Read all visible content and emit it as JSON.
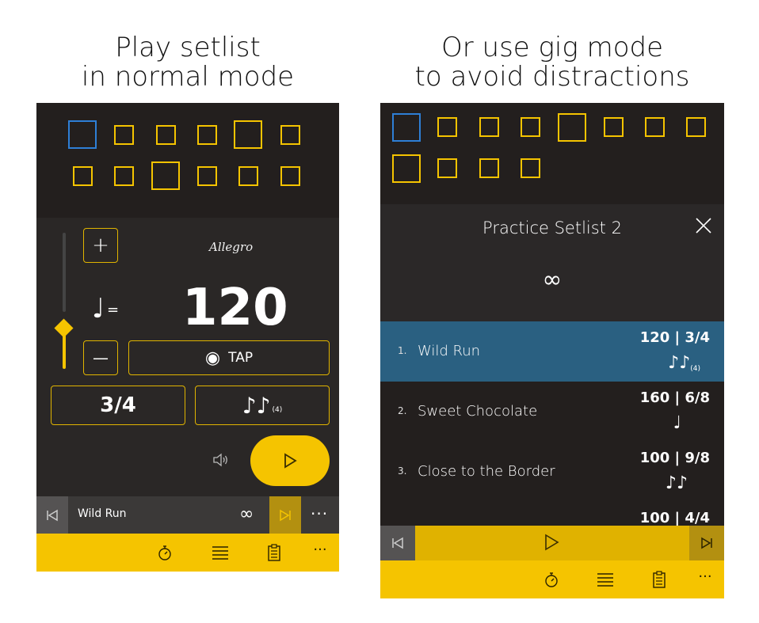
{
  "captions": {
    "left": [
      "Play setlist",
      "in normal mode"
    ],
    "right": [
      "Or use gig mode",
      "to avoid distractions"
    ]
  },
  "normal_mode": {
    "tempo_name": "Allegro",
    "note_symbol": "♩",
    "equals": "=",
    "bpm": "120",
    "plus_label": "+",
    "minus_label": "—",
    "tap_icon": "◉",
    "tap_label": "TAP",
    "time_signature": "3/4",
    "subdivision_notes": "♪♪",
    "subdivision_count": "(4)",
    "volume_icon": "speaker-icon",
    "current_song": "Wild Run",
    "infinity": "∞",
    "more": "···",
    "slider_level": 0.45
  },
  "gig_mode": {
    "setlist_title": "Practice Setlist 2",
    "infinity": "∞",
    "songs": [
      {
        "num": "1.",
        "name": "Wild Run",
        "meta": "120 | 3/4",
        "notes": "♪♪",
        "sub": "(4)",
        "active": true
      },
      {
        "num": "2.",
        "name": "Sweet Chocolate",
        "meta": "160 | 6/8",
        "notes": "♩",
        "sub": "",
        "active": false
      },
      {
        "num": "3.",
        "name": "Close to the Border",
        "meta": "100 | 9/8",
        "notes": "♪♪",
        "sub": "",
        "active": false
      },
      {
        "num": "",
        "name": "",
        "meta": "100 | 4/4",
        "notes": "",
        "sub": "",
        "active": false
      }
    ]
  },
  "app_bar": {
    "icons": [
      "stopwatch-icon",
      "list-icon",
      "clipboard-icon",
      "more-icon"
    ],
    "more": "···"
  },
  "colors": {
    "accent": "#f5c400",
    "beat_current": "#2e7fd6",
    "active_row": "#2a6081",
    "background": "#2a2726"
  }
}
